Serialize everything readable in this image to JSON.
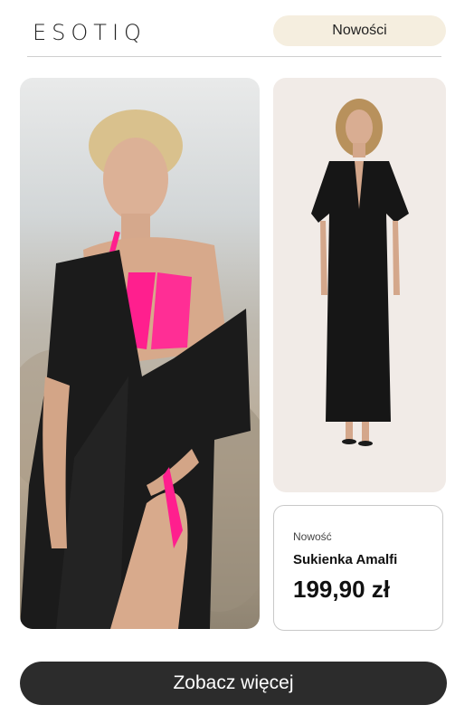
{
  "header": {
    "logo": "ESOTIQ",
    "nav_pill_label": "Nowości",
    "nav_pill_color": "#f5eedf"
  },
  "gallery": {
    "main_photo_label": "",
    "side_photo_label": ""
  },
  "product": {
    "badge": "Nowość",
    "name": "Sukienka Amalfi",
    "price": "199,90 zł"
  },
  "cta": {
    "label": "Zobacz więcej",
    "color": "#2c2c2c"
  }
}
